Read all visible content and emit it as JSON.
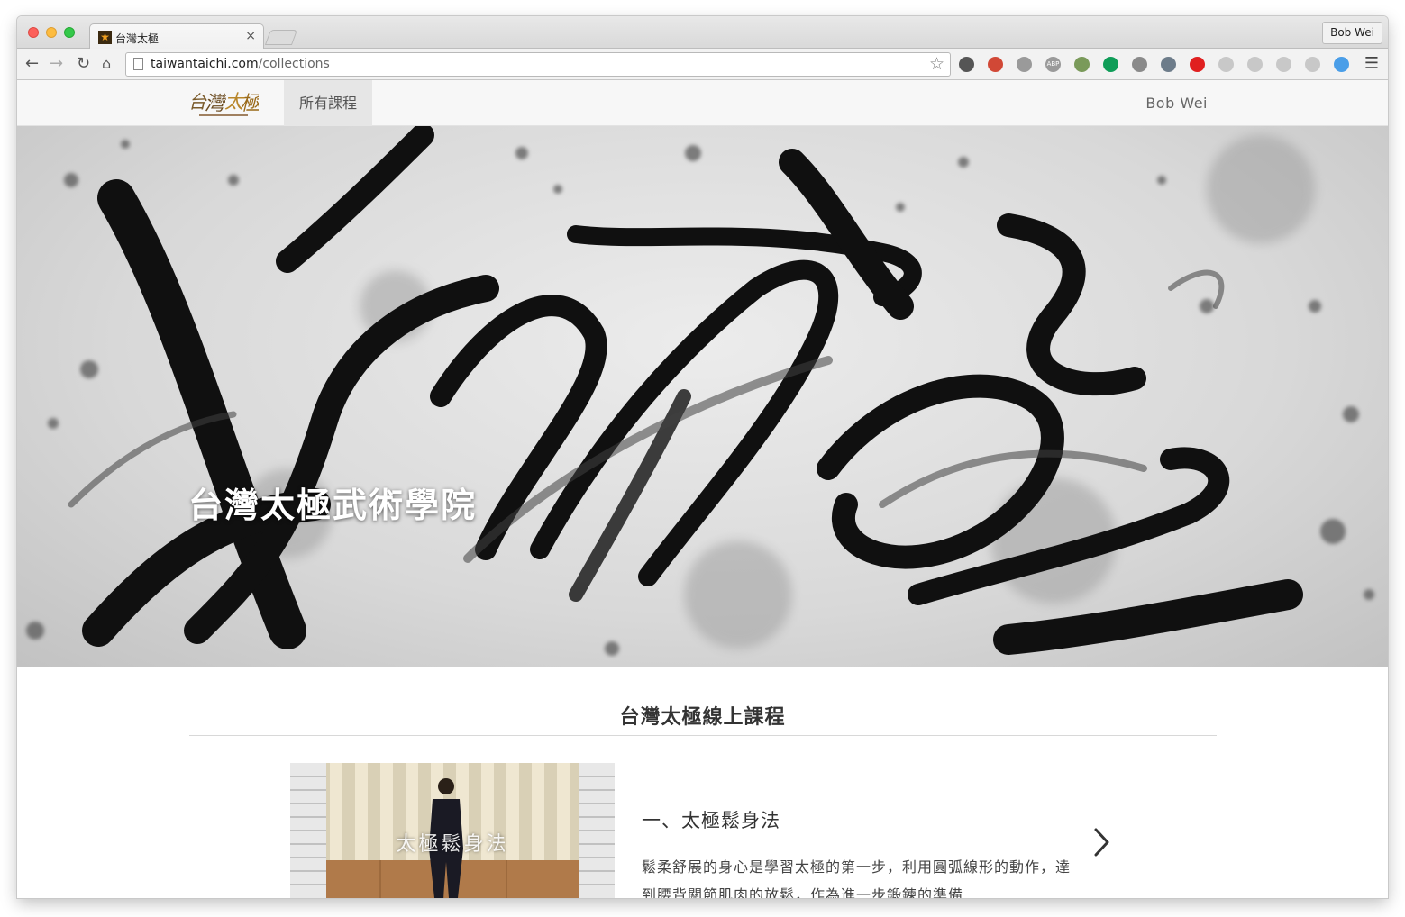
{
  "browser": {
    "tab_title": "台灣太極",
    "tab_close": "×",
    "profile_name": "Bob Wei",
    "url_host": "taiwantaichi.com",
    "url_path": "/collections",
    "extensions": [
      {
        "name": "sync-icon",
        "color": "#555555"
      },
      {
        "name": "gmail-icon",
        "color": "#d14836"
      },
      {
        "name": "check-icon",
        "color": "#9a9a9a"
      },
      {
        "name": "abp-icon",
        "color": "#9a9a9a"
      },
      {
        "name": "evernote-icon",
        "color": "#7a9a5a"
      },
      {
        "name": "hangouts-icon",
        "color": "#0f9d58"
      },
      {
        "name": "ghostery-icon",
        "color": "#8a8a8a"
      },
      {
        "name": "download-icon",
        "color": "#6d7c8a"
      },
      {
        "name": "pin-icon",
        "color": "#e02020"
      },
      {
        "name": "refresh-icon",
        "color": "#c8c8c8"
      },
      {
        "name": "react-icon",
        "color": "#c8c8c8"
      },
      {
        "name": "m-icon",
        "color": "#c8c8c8"
      },
      {
        "name": "note-icon",
        "color": "#c8c8c8"
      },
      {
        "name": "link-icon",
        "color": "#4a9ee8"
      }
    ],
    "abp_label": "ABP"
  },
  "site": {
    "nav_item": "所有課程",
    "user_name": "Bob Wei",
    "hero_title": "台灣太極武術學院",
    "section_title": "台灣太極線上課程",
    "courses": [
      {
        "thumb_caption": "太極鬆身法",
        "title": "一、太極鬆身法",
        "description": "鬆柔舒展的身心是學習太極的第一步，利用圓弧線形的動作，達到腰背關節肌肉的放鬆，作為進一步鍛鍊的準備"
      }
    ]
  },
  "colors": {
    "nav_bg": "#f7f7f7",
    "nav_active_bg": "#e6e6e6",
    "ink": "#111111"
  }
}
